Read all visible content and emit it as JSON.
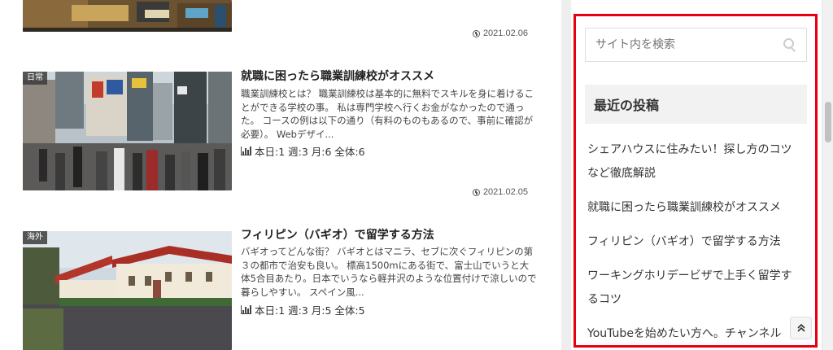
{
  "articles": [
    {
      "date": "2021.02.06"
    },
    {
      "category": "日常",
      "title": "就職に困ったら職業訓練校がオススメ",
      "snippet": "職業訓練校とは？ 職業訓練校は基本的に無料でスキルを身に着けることができる学校の事。 私は専門学校へ行くお金がなかったので通った。 コースの例は以下の通り（有料のものもあるので、事前に確認が必要）。 Webデザイ...",
      "views": "本日:1 週:3 月:6 全体:6",
      "date": "2021.02.05"
    },
    {
      "category": "海外",
      "title": "フィリピン（バギオ）で留学する方法",
      "snippet": "バギオってどんな街？ バギオとはマニラ、セブに次ぐフィリピンの第３の都市で治安も良い。 標高1500mにある街で、富士山でいうと大体5合目あたり。日本でいうなら軽井沢のような位置付けで涼しいので暮らしやすい。 スペイン風...",
      "views": "本日:1 週:3 月:5 全体:5"
    }
  ],
  "sidebar": {
    "search_placeholder": "サイト内を検索",
    "recent_heading": "最近の投稿",
    "recent_posts": [
      "シェアハウスに住みたい！探し方のコツなど徹底解説",
      "就職に困ったら職業訓練校がオススメ",
      "フィリピン（バギオ）で留学する方法",
      "ワーキングホリデービザで上手く留学するコツ",
      "YouTubeを始めたい方へ。チャンネル"
    ],
    "frame_color": "#e60012"
  },
  "icons": {
    "date": "clock-icon",
    "views": "bar-chart-icon",
    "search": "search-icon",
    "top": "chevron-up-double-icon"
  }
}
